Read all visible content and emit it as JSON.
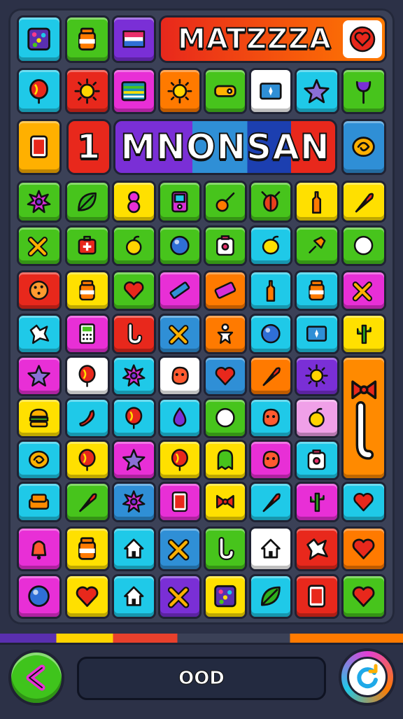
{
  "header": {
    "title": "MATZZZA",
    "title_bg": [
      "#ff3a1c",
      "#ff8a00"
    ]
  },
  "level_banner": {
    "level_number": "1",
    "name": "MNONSAN"
  },
  "status_bar": {
    "text": "OOD"
  },
  "buttons": {
    "back": "chevron-left-icon",
    "refresh": "refresh-icon"
  },
  "colors": {
    "back_button": "#3fc41c",
    "refresh_button": "#e23fd6",
    "board_bg": "#3b4157"
  },
  "tiles": [
    {
      "color": "#1fc9e8",
      "icon": "dice"
    },
    {
      "color": "#47c41c",
      "icon": "jar"
    },
    {
      "color": "#7a2fd6",
      "icon": "flag"
    },
    {
      "color": "#1fc9e8",
      "icon": "balloon"
    },
    {
      "color": "#e8281c",
      "icon": "sun"
    },
    {
      "color": "#e82fd6",
      "icon": "stripes"
    },
    {
      "color": "#ff7a00",
      "icon": "sun"
    },
    {
      "color": "#47c41c",
      "icon": "tag"
    },
    {
      "color": "#ffffff",
      "icon": "screen"
    },
    {
      "color": "#1fc9e8",
      "icon": "star"
    },
    {
      "color": "#47c41c",
      "icon": "fork"
    },
    {
      "color": "#ffb000",
      "icon": "card"
    },
    {
      "color": "#2f8fd6",
      "icon": "shell"
    },
    {
      "color": "#47c41c",
      "icon": "burst"
    },
    {
      "color": "#47c41c",
      "icon": "leaf"
    },
    {
      "color": "#ffe000",
      "icon": "figure8"
    },
    {
      "color": "#47c41c",
      "icon": "gameboy"
    },
    {
      "color": "#47c41c",
      "icon": "guitar"
    },
    {
      "color": "#47c41c",
      "icon": "bug"
    },
    {
      "color": "#ffe000",
      "icon": "bottle"
    },
    {
      "color": "#ffe000",
      "icon": "feather"
    },
    {
      "color": "#47c41c",
      "icon": "cross"
    },
    {
      "color": "#47c41c",
      "icon": "medkit"
    },
    {
      "color": "#47c41c",
      "icon": "apple"
    },
    {
      "color": "#47c41c",
      "icon": "orb"
    },
    {
      "color": "#47c41c",
      "icon": "box"
    },
    {
      "color": "#1fc9e8",
      "icon": "lemon"
    },
    {
      "color": "#47c41c",
      "icon": "pin"
    },
    {
      "color": "#47c41c",
      "icon": "circle"
    },
    {
      "color": "#e8281c",
      "icon": "cookie"
    },
    {
      "color": "#ffe000",
      "icon": "jar"
    },
    {
      "color": "#47c41c",
      "icon": "heart"
    },
    {
      "color": "#e82fd6",
      "icon": "ruler"
    },
    {
      "color": "#ff7a00",
      "icon": "brick"
    },
    {
      "color": "#1fc9e8",
      "icon": "bottle"
    },
    {
      "color": "#1fc9e8",
      "icon": "jar"
    },
    {
      "color": "#e82fd6",
      "icon": "cross"
    },
    {
      "color": "#1fc9e8",
      "icon": "splash"
    },
    {
      "color": "#e82fd6",
      "icon": "calc"
    },
    {
      "color": "#e8281c",
      "icon": "hook"
    },
    {
      "color": "#2f8fd6",
      "icon": "cross"
    },
    {
      "color": "#ff7a00",
      "icon": "man"
    },
    {
      "color": "#1fc9e8",
      "icon": "orb"
    },
    {
      "color": "#1fc9e8",
      "icon": "screen"
    },
    {
      "color": "#ffe000",
      "icon": "cactus"
    },
    {
      "color": "#e82fd6",
      "icon": "star"
    },
    {
      "color": "#ffffff",
      "icon": "balloon"
    },
    {
      "color": "#1fc9e8",
      "icon": "burst"
    },
    {
      "color": "#ffffff",
      "icon": "blob"
    },
    {
      "color": "#2f8fd6",
      "icon": "heart"
    },
    {
      "color": "#ff7a00",
      "icon": "feather"
    },
    {
      "color": "#7a2fd6",
      "icon": "sun"
    },
    {
      "color": "#ffe000",
      "icon": "burger"
    },
    {
      "color": "#1fc9e8",
      "icon": "chili"
    },
    {
      "color": "#1fc9e8",
      "icon": "balloon"
    },
    {
      "color": "#1fc9e8",
      "icon": "drop"
    },
    {
      "color": "#47c41c",
      "icon": "circle"
    },
    {
      "color": "#1fc9e8",
      "icon": "blob"
    },
    {
      "color": "#f0a0e8",
      "icon": "apple"
    },
    {
      "color": "#1fc9e8",
      "icon": "shell"
    },
    {
      "color": "#ffe000",
      "icon": "balloon"
    },
    {
      "color": "#e82fd6",
      "icon": "star"
    },
    {
      "color": "#ffe000",
      "icon": "balloon"
    },
    {
      "color": "#ffe000",
      "icon": "ghost"
    },
    {
      "color": "#e82fd6",
      "icon": "blob"
    },
    {
      "color": "#1fc9e8",
      "icon": "box"
    },
    {
      "color": "#1fc9e8",
      "icon": "sofa"
    },
    {
      "color": "#47c41c",
      "icon": "feather"
    },
    {
      "color": "#2f8fd6",
      "icon": "burst"
    },
    {
      "color": "#e82fd6",
      "icon": "card"
    },
    {
      "color": "#ffe000",
      "icon": "bow"
    },
    {
      "color": "#1fc9e8",
      "icon": "feather"
    },
    {
      "color": "#e82fd6",
      "icon": "cactus"
    },
    {
      "color": "#1fc9e8",
      "icon": "heart"
    },
    {
      "color": "#e82fd6",
      "icon": "bell"
    },
    {
      "color": "#ffe000",
      "icon": "jar"
    },
    {
      "color": "#1fc9e8",
      "icon": "house"
    },
    {
      "color": "#2f8fd6",
      "icon": "cross"
    },
    {
      "color": "#47c41c",
      "icon": "hook"
    },
    {
      "color": "#ffffff",
      "icon": "house"
    },
    {
      "color": "#e8281c",
      "icon": "splash"
    },
    {
      "color": "#ff7a00",
      "icon": "heart"
    },
    {
      "color": "#e82fd6",
      "icon": "orb"
    },
    {
      "color": "#ffe000",
      "icon": "heart"
    },
    {
      "color": "#1fc9e8",
      "icon": "house"
    },
    {
      "color": "#7a2fd6",
      "icon": "cross"
    },
    {
      "color": "#ffe000",
      "icon": "dice"
    },
    {
      "color": "#1fc9e8",
      "icon": "leaf"
    },
    {
      "color": "#e8281c",
      "icon": "card"
    },
    {
      "color": "#47c41c",
      "icon": "heart"
    }
  ],
  "side_tile": {
    "color": "#ff8a00",
    "icon": "bow"
  }
}
